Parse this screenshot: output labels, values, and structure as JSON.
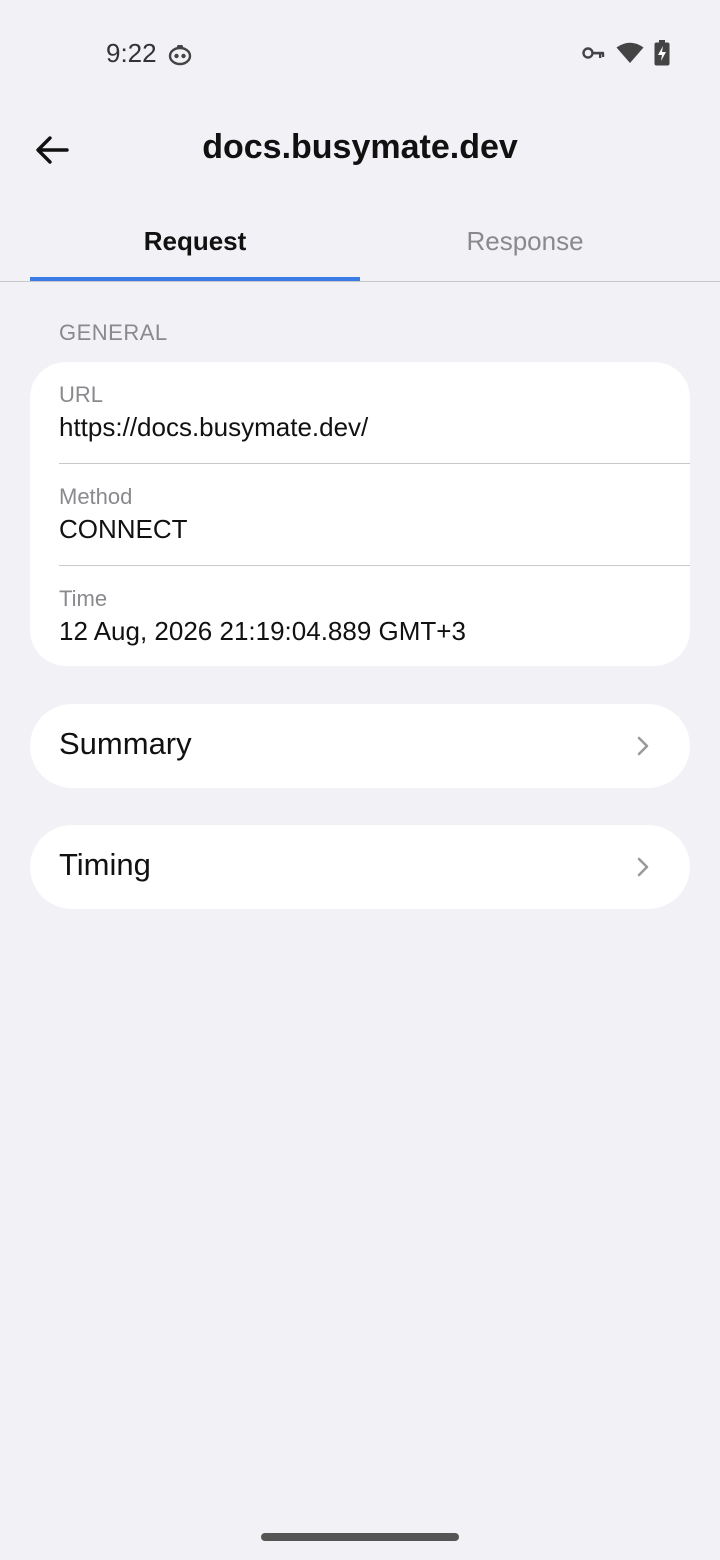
{
  "status_bar": {
    "time": "9:22",
    "icons": [
      "app-notification-icon",
      "vpn-key-icon",
      "wifi-icon",
      "battery-charging-icon"
    ]
  },
  "app_bar": {
    "title": "docs.busymate.dev",
    "back_icon": "arrow-back-icon"
  },
  "tabs": [
    {
      "label": "Request",
      "selected": true
    },
    {
      "label": "Response",
      "selected": false
    }
  ],
  "general": {
    "header": "GENERAL",
    "fields": [
      {
        "label": "URL",
        "value": "https://docs.busymate.dev/"
      },
      {
        "label": "Method",
        "value": "CONNECT"
      },
      {
        "label": "Time",
        "value": "12 Aug, 2026 21:19:04.889 GMT+3"
      }
    ]
  },
  "sections": [
    {
      "label": "Summary"
    },
    {
      "label": "Timing"
    }
  ],
  "colors": {
    "background": "#f1f1f6",
    "card": "#ffffff",
    "accent": "#3a7be6",
    "secondary_text": "#8a8a8e"
  }
}
